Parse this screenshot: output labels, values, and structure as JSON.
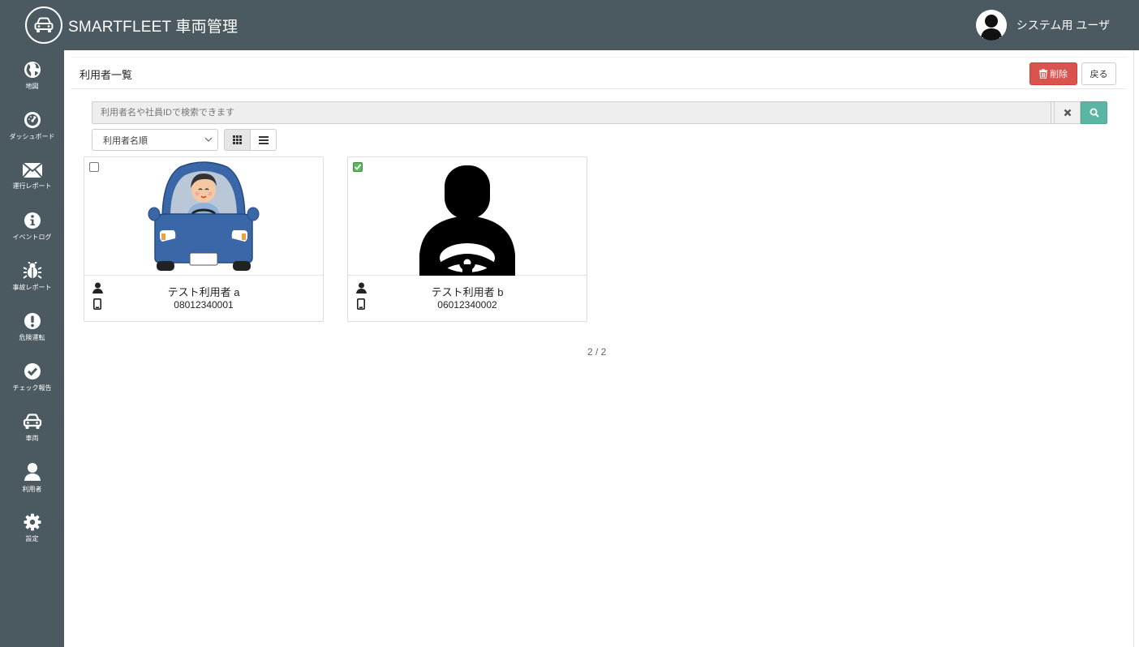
{
  "app": {
    "title": "SMARTFLEET 車両管理",
    "user_name": "システム用 ユーザ"
  },
  "sidebar": {
    "items": [
      {
        "label": "地図",
        "icon": "globe-icon"
      },
      {
        "label": "ダッシュボード",
        "icon": "dashboard-icon"
      },
      {
        "label": "運行レポート",
        "icon": "envelope-icon"
      },
      {
        "label": "イベントログ",
        "icon": "info-icon"
      },
      {
        "label": "事故レポート",
        "icon": "bug-icon"
      },
      {
        "label": "危険運転",
        "icon": "exclamation-icon"
      },
      {
        "label": "チェック報告",
        "icon": "check-circle-icon"
      },
      {
        "label": "車両",
        "icon": "car-icon"
      },
      {
        "label": "利用者",
        "icon": "user-icon"
      },
      {
        "label": "設定",
        "icon": "gear-icon"
      }
    ]
  },
  "header": {
    "title": "利用者一覧",
    "delete_label": "削除",
    "back_label": "戻る"
  },
  "search": {
    "placeholder": "利用者名や社員IDで検索できます"
  },
  "sort": {
    "selected": "利用者名順"
  },
  "cards": [
    {
      "name": "テスト利用者 a",
      "phone": "08012340001",
      "checked": false,
      "image": "driver-in-blue-car"
    },
    {
      "name": "テスト利用者 b",
      "phone": "06012340002",
      "checked": true,
      "image": "driver-silhouette"
    }
  ],
  "pager": {
    "text": "2 / 2"
  },
  "colors": {
    "chrome": "#4a5a60",
    "danger": "#d9534f",
    "search_button": "#5bb5a5",
    "checked": "#5cb85c",
    "car_blue": "#3a67a8"
  }
}
